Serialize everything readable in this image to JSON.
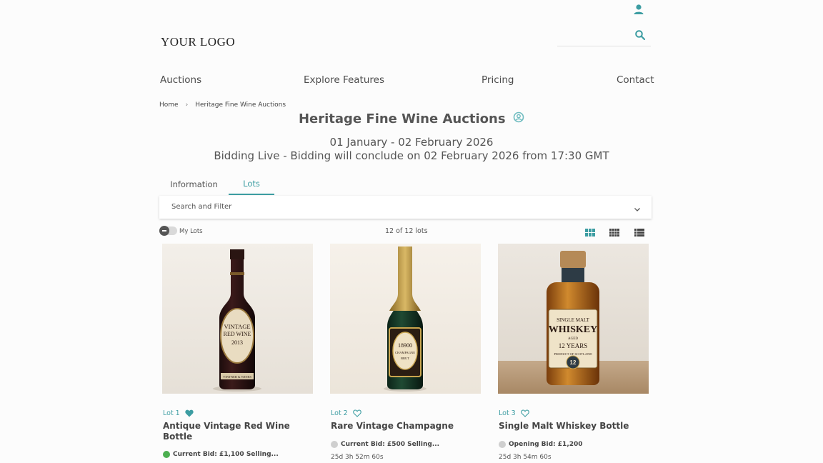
{
  "header": {
    "logo_text": "YOUR LOGO",
    "search_placeholder": ""
  },
  "nav": {
    "items": [
      {
        "label": "Auctions"
      },
      {
        "label": "Explore Features"
      },
      {
        "label": "Pricing"
      },
      {
        "label": "Contact"
      }
    ]
  },
  "breadcrumb": {
    "home": "Home",
    "separator": "›",
    "current": "Heritage Fine Wine Auctions"
  },
  "auction": {
    "title": "Heritage Fine Wine Auctions",
    "date_range": "01 January - 02 February 2026",
    "status_line": "Bidding Live - Bidding will conclude on 02 February 2026 from 17:30 GMT"
  },
  "tabs": [
    {
      "label": "Information",
      "active": false
    },
    {
      "label": "Lots",
      "active": true
    }
  ],
  "filter": {
    "label": "Search and Filter"
  },
  "toolbar": {
    "my_lots_label": "My Lots",
    "lot_count": "12 of 12 lots",
    "views": [
      "large-grid",
      "small-grid",
      "list"
    ],
    "active_view": "large-grid"
  },
  "lots": [
    {
      "lot_label": "Lot 1",
      "favorited": true,
      "name": "Antique Vintage Red Wine Bottle",
      "bid_text": "Current Bid: £1,100 Selling...",
      "status_color": "#4caf50",
      "timer": "",
      "bottle_label_lines": [
        "VINTAGE",
        "RED WINE",
        "2013"
      ],
      "bottle_label_footer": "VINTNER & WINES"
    },
    {
      "lot_label": "Lot 2",
      "favorited": false,
      "name": "Rare Vintage Champagne",
      "bid_text": "Current Bid: £500 Selling...",
      "status_color": "#cfcfcf",
      "timer": "25d 3h 52m 60s",
      "bottle_label_lines": [
        "18900",
        "CHAMPAGNE",
        "BRUT"
      ],
      "bottle_label_footer": ""
    },
    {
      "lot_label": "Lot 3",
      "favorited": false,
      "name": "Single Malt Whiskey Bottle",
      "bid_text": "Opening Bid: £1,200",
      "status_color": "#cfcfcf",
      "timer": "25d 3h 54m 60s",
      "bottle_label_lines": [
        "SINGLE MALT",
        "WHISKEY",
        "AGED",
        "12 YEARS",
        "PRODUCT OF SCOTLAND"
      ],
      "bottle_label_footer": "12"
    }
  ],
  "colors": {
    "accent": "#3d9da2",
    "text": "#555555",
    "live_dot": "#4caf50",
    "idle_dot": "#cfcfcf"
  }
}
